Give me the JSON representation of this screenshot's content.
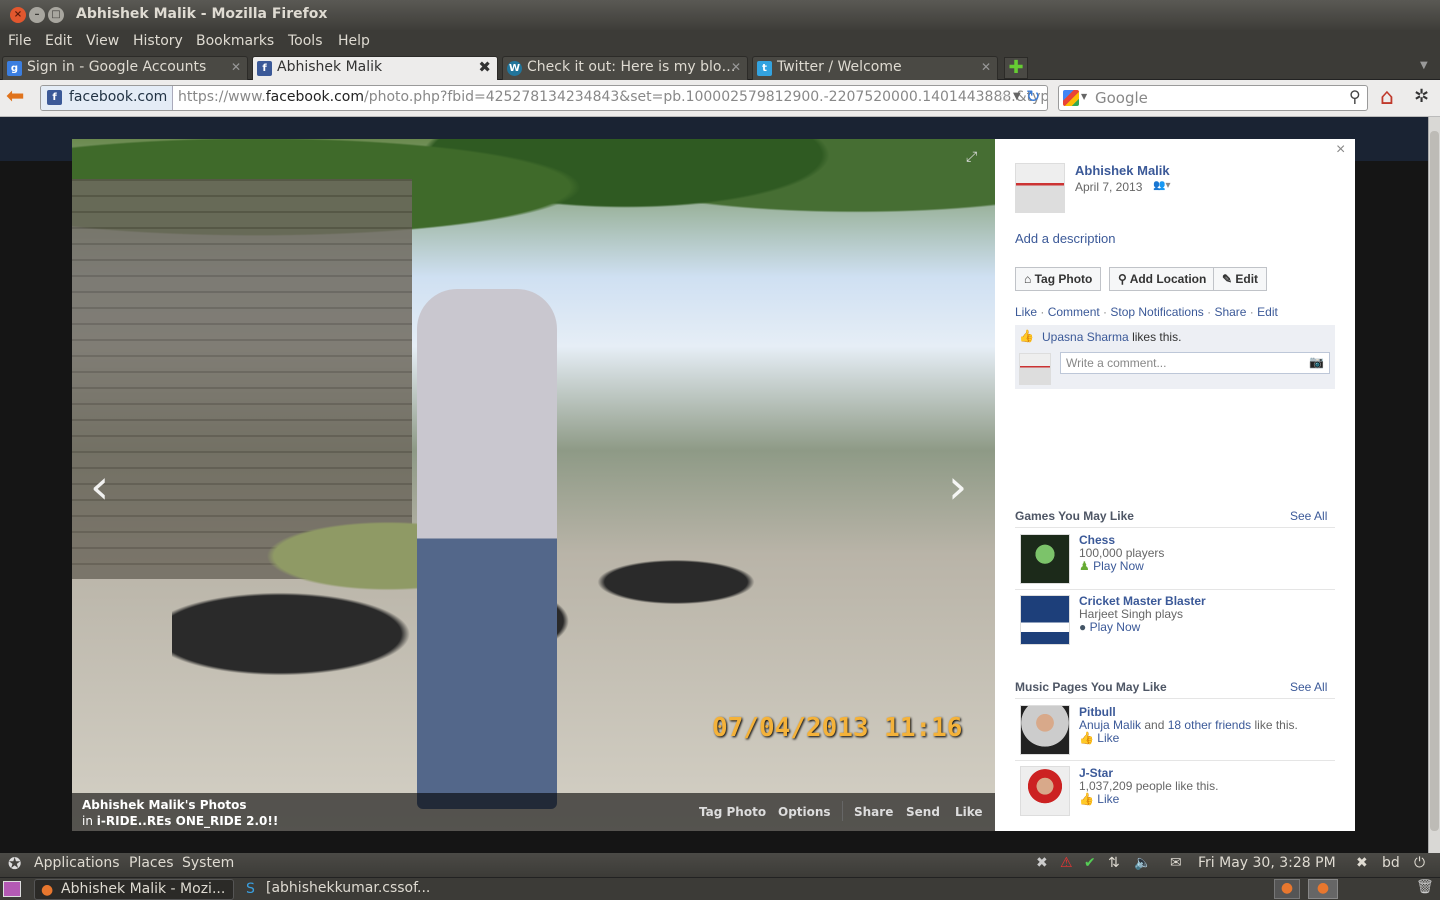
{
  "window": {
    "title": "Abhishek Malik - Mozilla Firefox"
  },
  "menu": [
    "File",
    "Edit",
    "View",
    "History",
    "Bookmarks",
    "Tools",
    "Help"
  ],
  "tabs": [
    {
      "label": "Sign in - Google Accounts",
      "icon": "google-icon"
    },
    {
      "label": "Abhishek Malik",
      "icon": "facebook-icon",
      "active": true
    },
    {
      "label": "Check it out: Here is my blo…",
      "icon": "wordpress-icon"
    },
    {
      "label": "Twitter / Welcome",
      "icon": "twitter-icon"
    }
  ],
  "nav": {
    "site": "facebook.com",
    "url_prefix": "https://www.",
    "url_domain": "facebook.com",
    "url_rest": "/photo.php?fbid=425278134234843&set=pb.100002579812900.-2207520000.1401443888.&typ",
    "search_placeholder": "Google"
  },
  "photo": {
    "timestamp": "07/04/2013  11:16",
    "caption_title": "Abhishek Malik's Photos",
    "caption_in": "in",
    "caption_album": "i-RIDE..REs ONE_RIDE 2.0!!",
    "actions": [
      "Tag Photo",
      "Options",
      "Share",
      "Send",
      "Like"
    ]
  },
  "side": {
    "close": "×",
    "owner": "Abhishek Malik",
    "date": "April 7, 2013",
    "add_description": "Add a description",
    "buttons": [
      "Tag Photo",
      "Add Location",
      "Edit"
    ],
    "actions": [
      "Like",
      "Comment",
      "Stop Notifications",
      "Share",
      "Edit"
    ],
    "liker": "Upasna Sharma",
    "likes_text": "likes this.",
    "comment_placeholder": "Write a comment...",
    "games_heading": "Games You May Like",
    "see_all": "See All",
    "games": [
      {
        "name": "Chess",
        "sub": "100,000 players",
        "action": "Play Now"
      },
      {
        "name": "Cricket Master Blaster",
        "sub": "Harjeet Singh plays",
        "action": "Play Now"
      }
    ],
    "music_heading": "Music Pages You May Like",
    "music": [
      {
        "name": "Pitbull",
        "sub_a": "Anuja Malik",
        "sub_b": "and",
        "sub_c": "18 other friends",
        "sub_d": "like this.",
        "action": "Like"
      },
      {
        "name": "J-Star",
        "sub_a": "1,037,209 people like this.",
        "action": "Like"
      }
    ]
  },
  "taskbar": {
    "items": [
      "Applications",
      "Places",
      "System"
    ],
    "clock": "Fri May 30,  3:28 PM",
    "user": "bd"
  },
  "bottom": {
    "tasks": [
      "Abhishek Malik - Mozi...",
      "[abhishekkumar.cssof..."
    ]
  }
}
